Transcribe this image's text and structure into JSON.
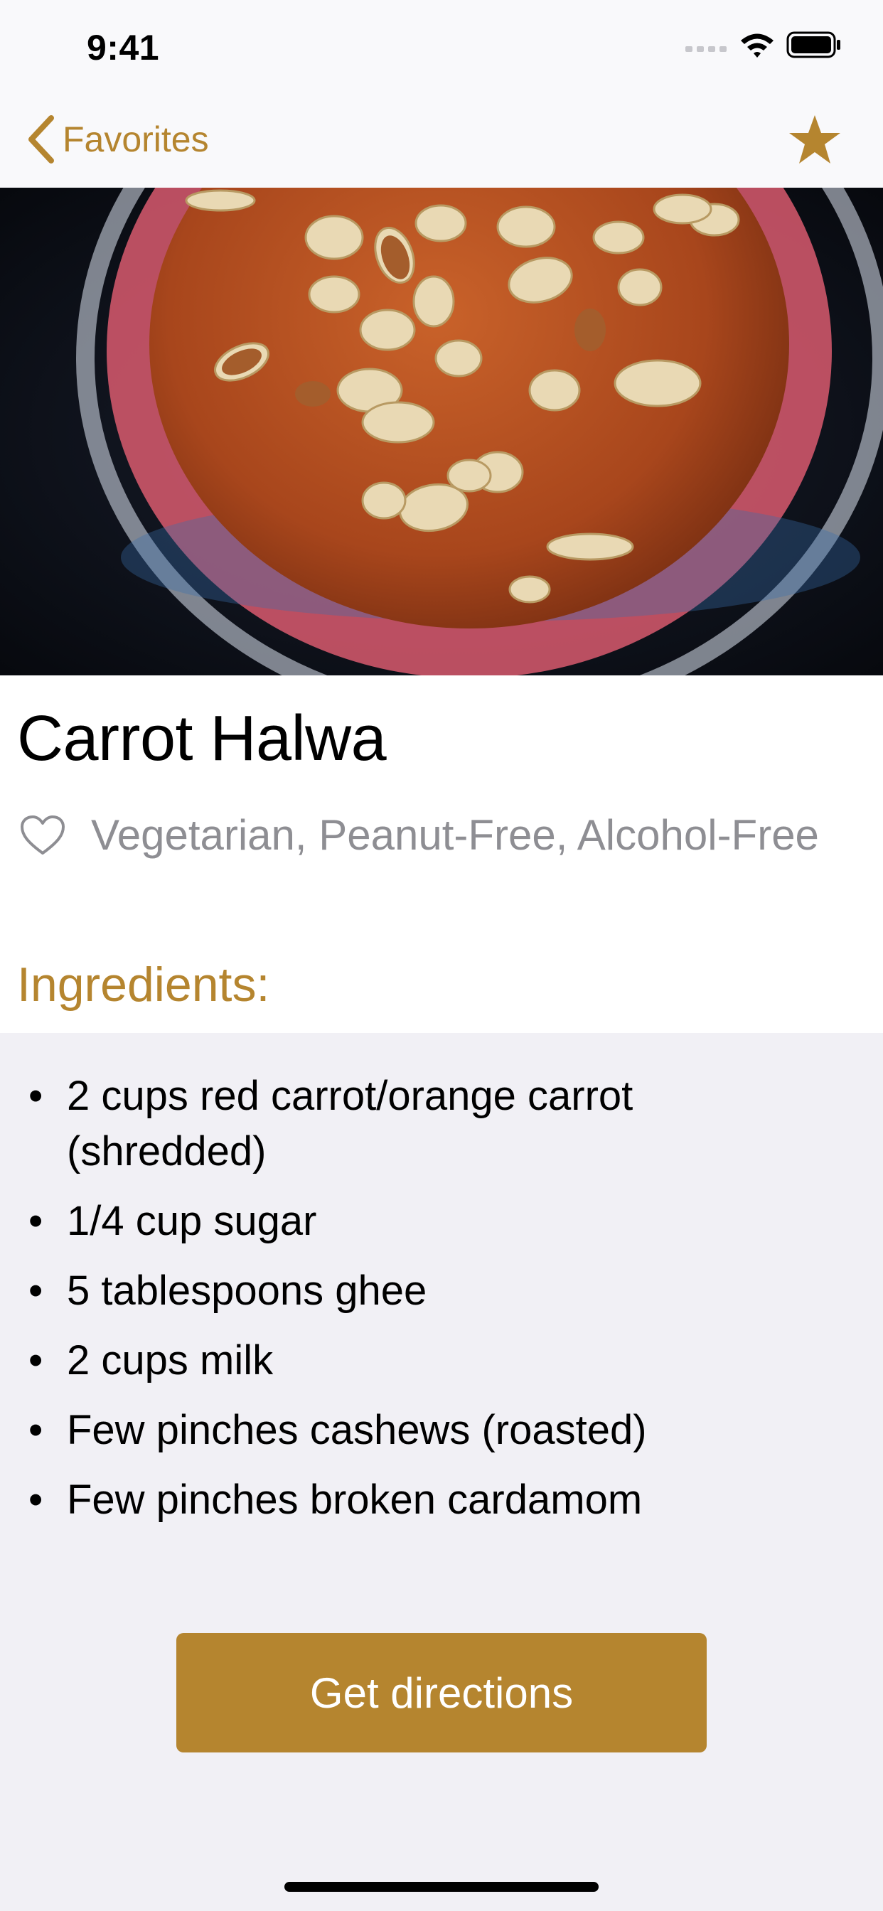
{
  "status_bar": {
    "time": "9:41"
  },
  "nav": {
    "back_label": "Favorites"
  },
  "recipe": {
    "title": "Carrot Halwa",
    "tags": "Vegetarian, Peanut-Free, Alcohol-Free",
    "ingredients_heading": "Ingredients:",
    "ingredients": [
      "2 cups red carrot/orange carrot (shredded)",
      "1/4 cup sugar",
      "5 tablespoons ghee",
      "2 cups milk",
      "Few pinches cashews (roasted)",
      "Few pinches broken cardamom"
    ]
  },
  "actions": {
    "directions_label": "Get directions"
  },
  "colors": {
    "accent": "#b5852f",
    "background": "#f1f0f5",
    "secondary_text": "#8e8e93"
  },
  "icons": [
    "cellular-icon",
    "wifi-icon",
    "battery-icon",
    "chevron-left-icon",
    "star-icon",
    "heart-icon"
  ]
}
